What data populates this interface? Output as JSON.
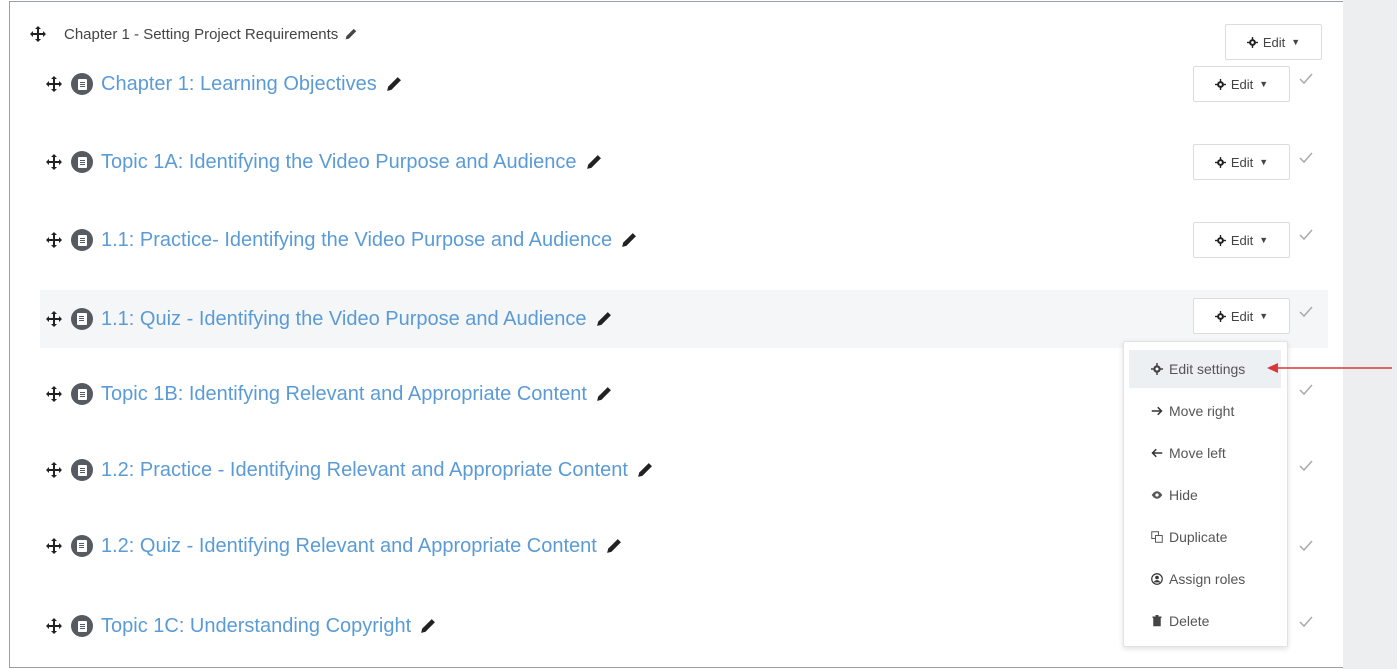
{
  "section": {
    "title": "Chapter 1 - Setting Project Requirements",
    "edit_label": "Edit"
  },
  "activities": [
    {
      "title": "Chapter 1: Learning Objectives",
      "type": "page",
      "edit_label": "Edit"
    },
    {
      "title": "Topic 1A: Identifying the Video Purpose and Audience",
      "type": "page",
      "edit_label": "Edit"
    },
    {
      "title": "1.1: Practice- Identifying the Video Purpose and Audience",
      "type": "page",
      "edit_label": "Edit"
    },
    {
      "title": "1.1: Quiz - Identifying the Video Purpose and Audience",
      "type": "quiz",
      "edit_label": "Edit"
    },
    {
      "title": "Topic 1B: Identifying Relevant and Appropriate Content",
      "type": "page"
    },
    {
      "title": "1.2: Practice - Identifying Relevant and Appropriate Content",
      "type": "page"
    },
    {
      "title": "1.2: Quiz - Identifying Relevant and Appropriate Content",
      "type": "quiz"
    },
    {
      "title": "Topic 1C: Understanding Copyright",
      "type": "page"
    }
  ],
  "edit_menu": {
    "items": [
      {
        "label": "Edit settings",
        "icon": "gear-icon",
        "active": true
      },
      {
        "label": "Move right",
        "icon": "arrow-right-icon"
      },
      {
        "label": "Move left",
        "icon": "arrow-left-icon"
      },
      {
        "label": "Hide",
        "icon": "eye-icon"
      },
      {
        "label": "Duplicate",
        "icon": "duplicate-icon"
      },
      {
        "label": "Assign roles",
        "icon": "user-circle-icon"
      },
      {
        "label": "Delete",
        "icon": "trash-icon"
      }
    ]
  },
  "colors": {
    "link": "#5b9bd5",
    "annotation_arrow": "#d9363e",
    "activity_icon": "#555b61"
  }
}
